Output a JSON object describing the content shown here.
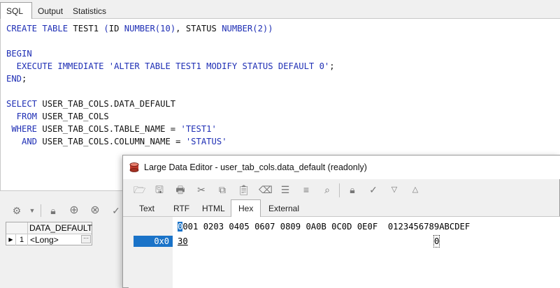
{
  "tabs": [
    {
      "label": "SQL",
      "active": true
    },
    {
      "label": "Output",
      "active": false
    },
    {
      "label": "Statistics",
      "active": false
    }
  ],
  "editor": {
    "lines": [
      [
        {
          "t": "CREATE TABLE ",
          "c": "kw"
        },
        {
          "t": "TEST1 ",
          "c": "plain"
        },
        {
          "t": "(",
          "c": "kw"
        },
        {
          "t": "ID ",
          "c": "plain"
        },
        {
          "t": "NUMBER(10)",
          "c": "kw"
        },
        {
          "t": ", STATUS ",
          "c": "plain"
        },
        {
          "t": "NUMBER(2))",
          "c": "kw"
        }
      ],
      [],
      [
        {
          "t": "BEGIN",
          "c": "kw"
        }
      ],
      [
        {
          "t": "  EXECUTE IMMEDIATE ",
          "c": "kw"
        },
        {
          "t": "'ALTER TABLE TEST1 MODIFY STATUS DEFAULT 0'",
          "c": "str"
        },
        {
          "t": ";",
          "c": "plain"
        }
      ],
      [
        {
          "t": "END",
          "c": "kw"
        },
        {
          "t": ";",
          "c": "plain"
        }
      ],
      [],
      [
        {
          "t": "SELECT ",
          "c": "kw"
        },
        {
          "t": "USER_TAB_COLS.DATA_DEFAULT",
          "c": "plain"
        }
      ],
      [
        {
          "t": "  FROM ",
          "c": "kw"
        },
        {
          "t": "USER_TAB_COLS",
          "c": "plain"
        }
      ],
      [
        {
          "t": " WHERE ",
          "c": "kw"
        },
        {
          "t": "USER_TAB_COLS.TABLE_NAME = ",
          "c": "plain"
        },
        {
          "t": "'TEST1'",
          "c": "str"
        }
      ],
      [
        {
          "t": "   AND ",
          "c": "kw"
        },
        {
          "t": "USER_TAB_COLS.COLUMN_NAME = ",
          "c": "plain"
        },
        {
          "t": "'STATUS'",
          "c": "str"
        }
      ]
    ]
  },
  "grid": {
    "column_header": "DATA_DEFAULT",
    "rows": [
      {
        "num": "1",
        "value": "<Long>",
        "button": "···"
      }
    ]
  },
  "dialog": {
    "title": "Large Data Editor - user_tab_cols.data_default (readonly)",
    "tabs": [
      {
        "label": "Text",
        "active": false
      },
      {
        "label": "RTF",
        "active": false
      },
      {
        "label": "HTML",
        "active": false
      },
      {
        "label": "Hex",
        "active": true
      },
      {
        "label": "External",
        "active": false
      }
    ],
    "hex": {
      "header_cursor": "0",
      "header_rest": "001 0203 0405 0607 0809 0A0B 0C0D 0E0F  0123456789ABCDEF",
      "address": "0x0",
      "bytes": "30",
      "ascii": "0"
    }
  },
  "colors": {
    "keyword": "#1f2fb5",
    "selection": "#1a73c8"
  }
}
